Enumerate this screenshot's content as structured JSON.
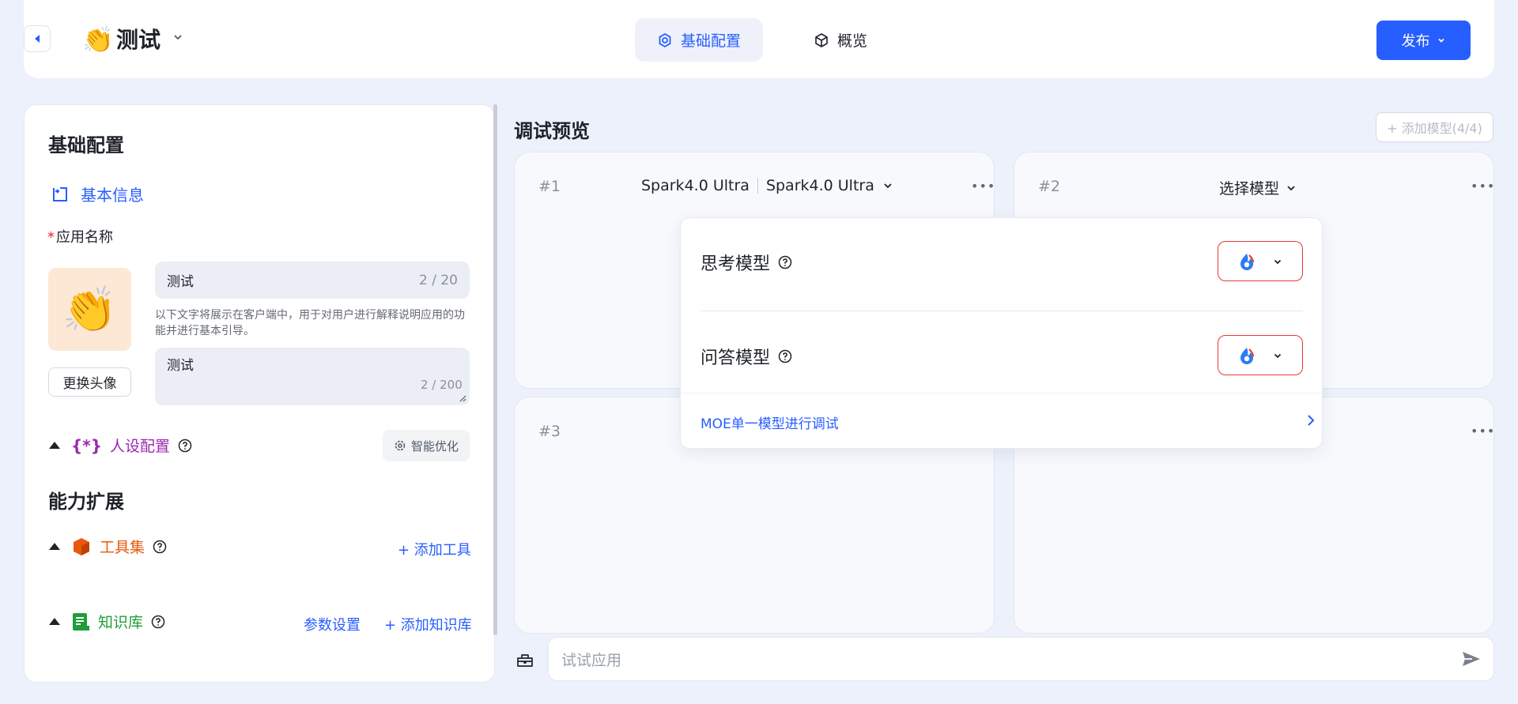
{
  "header": {
    "app_emoji": "👏",
    "app_title": "测试",
    "tabs": [
      {
        "label": "基础配置",
        "active": true
      },
      {
        "label": "概览",
        "active": false
      }
    ],
    "publish_label": "发布"
  },
  "left": {
    "section_title": "基础配置",
    "basic_info_label": "基本信息",
    "app_name_label": "应用名称",
    "avatar_emoji": "👏",
    "change_avatar_label": "更换头像",
    "name_value": "测试",
    "name_count": "2 / 20",
    "hint": "以下文字将展示在客户端中，用于对用户进行解释说明应用的功能并进行基本引导。",
    "desc_value": "测试",
    "desc_count": "2 / 200",
    "persona_label": "人设配置",
    "persona_icon_text": "{*}",
    "optimize_label": "智能优化",
    "ability_title": "能力扩展",
    "toolset_label": "工具集",
    "add_tool_label": "+ 添加工具",
    "kb_label": "知识库",
    "param_set_label": "参数设置",
    "add_kb_label": "+ 添加知识库"
  },
  "debug": {
    "title": "调试预览",
    "add_model_label": "+ 添加模型(4/4)",
    "cards": [
      {
        "num": "#1",
        "model_a": "Spark4.0 Ultra",
        "model_b": "Spark4.0 Ultra"
      },
      {
        "num": "#2",
        "select_label": "选择模型"
      },
      {
        "num": "#3"
      },
      {
        "num": ""
      }
    ],
    "more_label": "•••",
    "popover": {
      "think_label": "思考模型",
      "qa_label": "问答模型",
      "moe_label": "MOE单一模型进行调试"
    },
    "chat_placeholder": "试试应用"
  },
  "colors": {
    "accent": "#275eff",
    "background": "#ecf1fb",
    "error_border": "#e53935",
    "persona": "#9c27b0",
    "toolset": "#e8590c",
    "knowledge": "#1e9e3a"
  }
}
